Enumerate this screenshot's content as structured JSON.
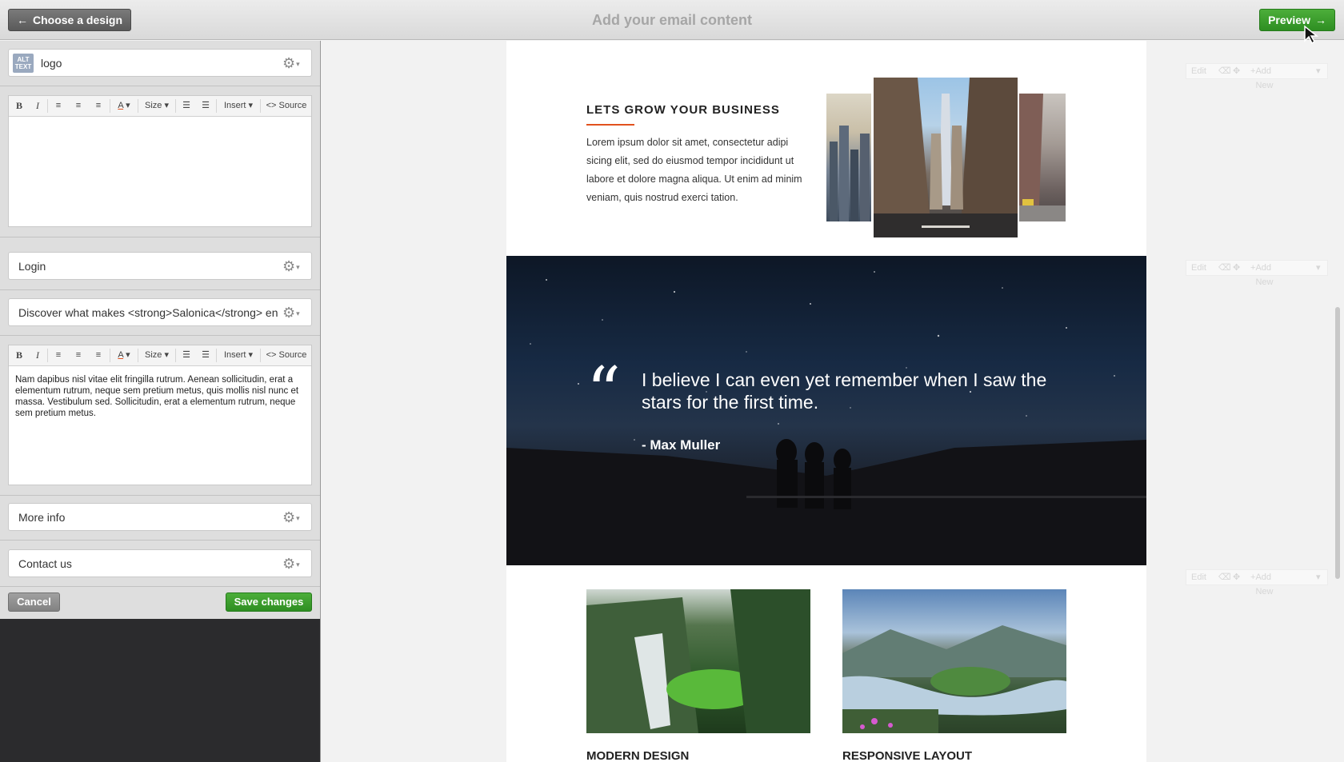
{
  "topbar": {
    "back_label": "Choose a design",
    "title": "Add your email content",
    "preview_label": "Preview"
  },
  "fields": {
    "logo": {
      "alt_badge_line1": "ALT",
      "alt_badge_line2": "TEXT",
      "label": "logo"
    },
    "login": {
      "label": "Login"
    },
    "discover": {
      "label": "Discover what makes <strong>Salonica</strong> en"
    },
    "more_info": {
      "label": "More info"
    },
    "contact": {
      "label": "Contact us"
    }
  },
  "toolbar": {
    "bold": "B",
    "italic": "I",
    "size_label": "Size",
    "insert_label": "Insert",
    "source_label": "Source"
  },
  "editor2_text": "Nam dapibus nisl vitae elit fringilla rutrum. Aenean sollicitudin, erat a elementum rutrum, neque sem pretium metus, quis mollis nisl nunc et massa. Vestibulum sed. Sollicitudin, erat a elementum rutrum, neque sem pretium metus.",
  "actions": {
    "cancel_label": "Cancel",
    "save_label": "Save changes"
  },
  "email": {
    "section1": {
      "title": "LETS GROW YOUR BUSINESS",
      "body": "Lorem ipsum dolor sit amet, consectetur adipi sicing elit, sed do eiusmod tempor incididunt ut labore et dolore magna aliqua. Ut enim ad minim veniam, quis nostrud exerci tation."
    },
    "quote": {
      "mark": "“",
      "text": "I believe I can even yet remember when I saw the stars for the first time.",
      "author": "- Max Muller"
    },
    "columns": [
      {
        "title": "MODERN DESIGN"
      },
      {
        "title": "RESPONSIVE LAYOUT"
      }
    ]
  },
  "block_controls": {
    "edit_label": "Edit",
    "add_new_label": "Add New"
  },
  "colors": {
    "accent_green": "#2e8e22",
    "accent_orange": "#e2521e"
  }
}
